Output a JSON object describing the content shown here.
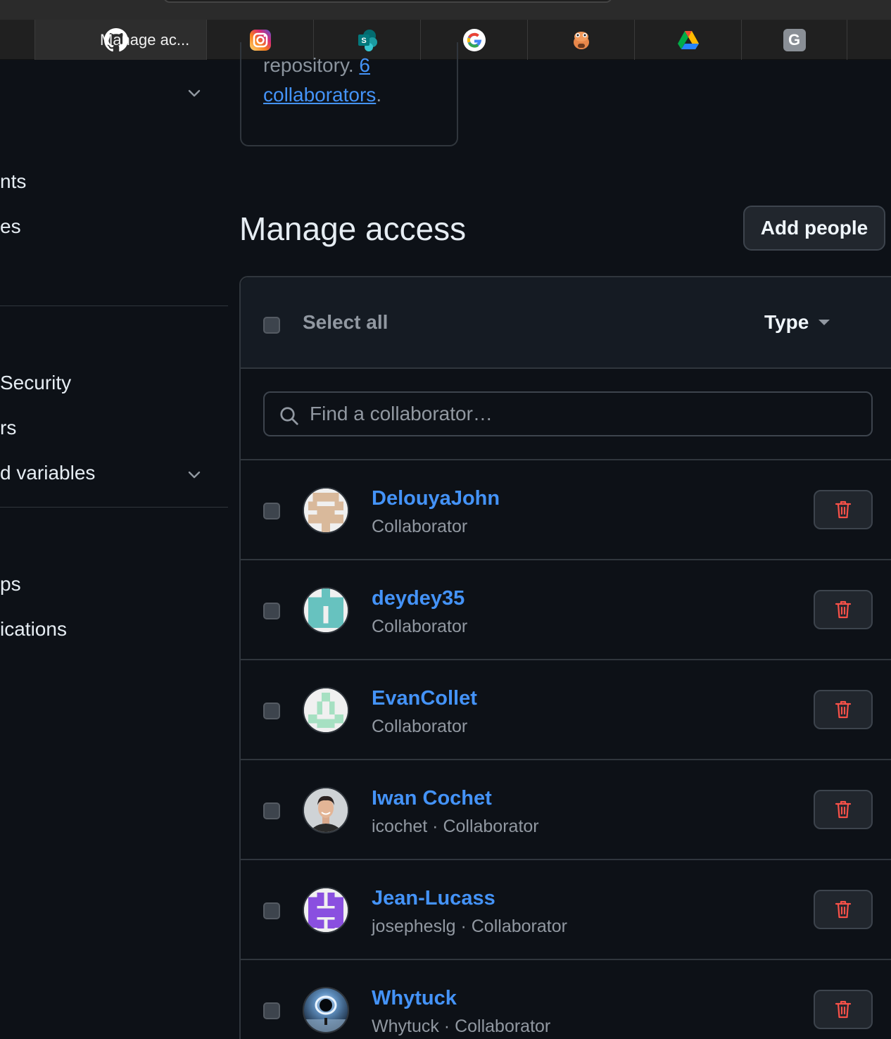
{
  "browser": {
    "active_tab_title": "Manage ac...",
    "tabs": [
      {
        "icon": "github-icon"
      },
      {
        "icon": "instagram-icon"
      },
      {
        "icon": "sharepoint-icon"
      },
      {
        "icon": "google-icon"
      },
      {
        "icon": "mascot-icon"
      },
      {
        "icon": "google-drive-icon"
      },
      {
        "icon": "g-letter-icon",
        "letter": "G"
      }
    ]
  },
  "sidebar": {
    "items": [
      {
        "label": "nts"
      },
      {
        "label": "es"
      },
      {
        "label": "Security"
      },
      {
        "label": "rs"
      },
      {
        "label": "d variables"
      },
      {
        "label": "ps"
      },
      {
        "label": "ications"
      }
    ]
  },
  "info": {
    "text_before": "repository. ",
    "count_link": "6",
    "collab_link": "collaborators",
    "text_after": "."
  },
  "main": {
    "title": "Manage access",
    "add_button": "Add people",
    "select_all": "Select all",
    "type_filter": "Type",
    "search_placeholder": "Find a collaborator…"
  },
  "collaborators": [
    {
      "name": "DelouyaJohn",
      "username": "",
      "role": "Collaborator",
      "avatar": "identicon-tan"
    },
    {
      "name": "deydey35",
      "username": "",
      "role": "Collaborator",
      "avatar": "identicon-teal"
    },
    {
      "name": "EvanCollet",
      "username": "",
      "role": "Collaborator",
      "avatar": "identicon-green"
    },
    {
      "name": "Iwan Cochet",
      "username": "icochet",
      "role": "Collaborator",
      "avatar": "photo-portrait"
    },
    {
      "name": "Jean-Lucass",
      "username": "josepheslg",
      "role": "Collaborator",
      "avatar": "identicon-purple"
    },
    {
      "name": "Whytuck",
      "username": "Whytuck",
      "role": "Collaborator",
      "avatar": "photo-space"
    }
  ],
  "colors": {
    "background": "#0d1117",
    "link": "#4493f8",
    "danger": "#f85149",
    "border": "#30363d"
  }
}
